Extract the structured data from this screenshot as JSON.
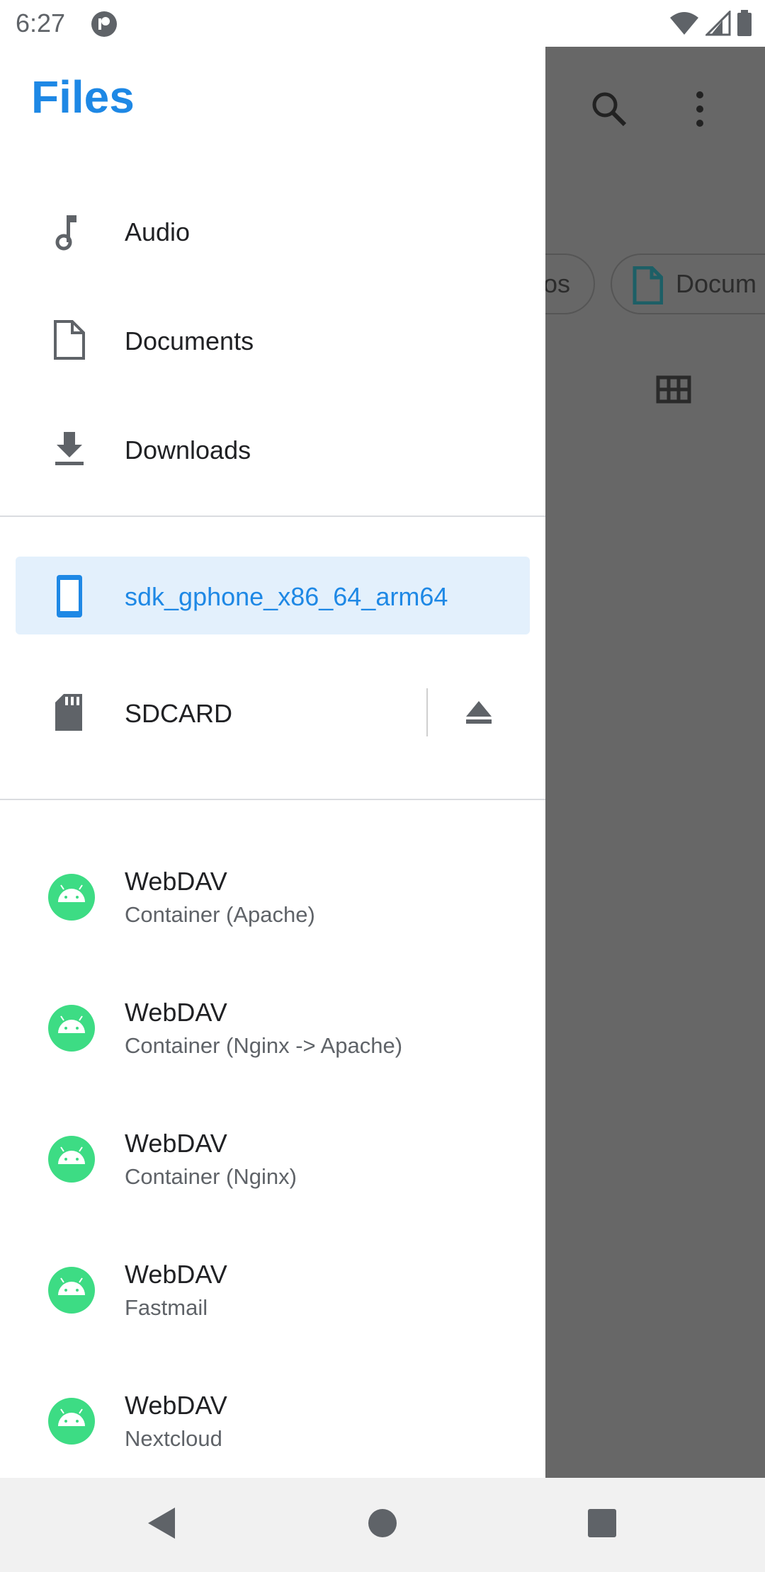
{
  "status_bar": {
    "time": "6:27"
  },
  "drawer": {
    "title": "Files",
    "categories": [
      {
        "label": "Audio",
        "icon": "music-note-icon"
      },
      {
        "label": "Documents",
        "icon": "document-icon"
      },
      {
        "label": "Downloads",
        "icon": "download-icon"
      }
    ],
    "devices": [
      {
        "label": "sdk_gphone_x86_64_arm64",
        "icon": "phone-icon",
        "selected": true
      },
      {
        "label": "SDCARD",
        "icon": "sd-card-icon",
        "eject": "eject-icon"
      }
    ],
    "providers": [
      {
        "title": "WebDAV",
        "subtitle": "Container (Apache)"
      },
      {
        "title": "WebDAV",
        "subtitle": "Container (Nginx -> Apache)"
      },
      {
        "title": "WebDAV",
        "subtitle": "Container (Nginx)"
      },
      {
        "title": "WebDAV",
        "subtitle": "Fastmail"
      },
      {
        "title": "WebDAV",
        "subtitle": "Nextcloud"
      }
    ]
  },
  "background_app": {
    "chips": [
      {
        "label": "os"
      },
      {
        "label": "Docum"
      }
    ]
  },
  "colors": {
    "accent": "#1e88e5",
    "selected_bg": "#e3f0fc",
    "scrim": "#676767",
    "android_green": "#3ddc84"
  }
}
